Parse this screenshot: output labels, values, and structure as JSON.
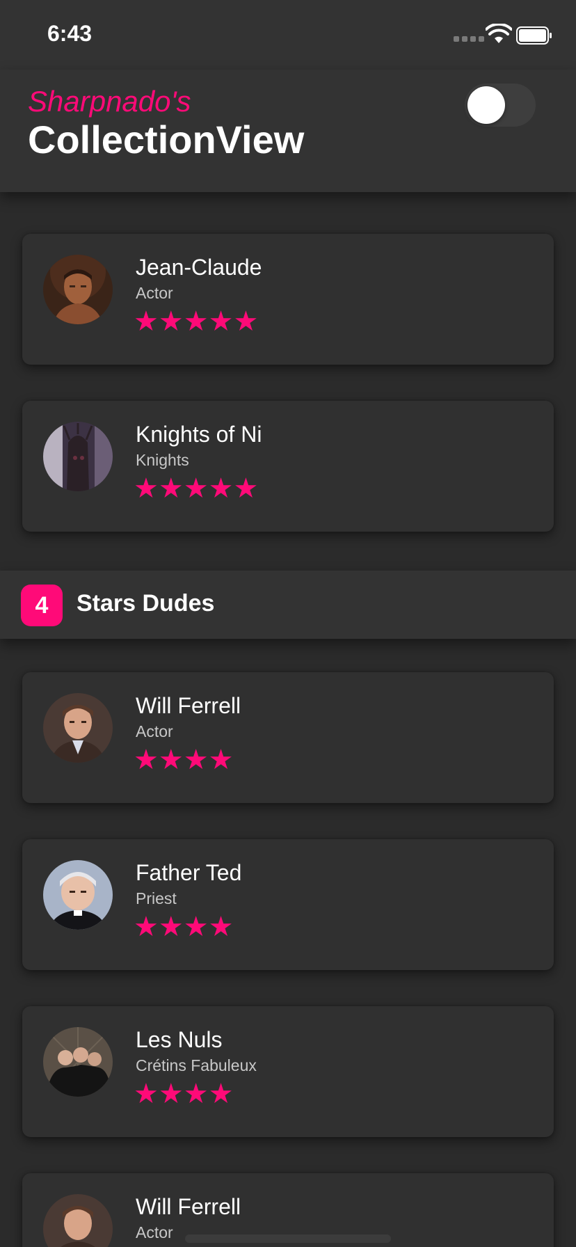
{
  "status_bar": {
    "time": "6:43"
  },
  "header": {
    "subtitle": "Sharpnado's",
    "title": "CollectionView"
  },
  "section_header": {
    "badge": "4",
    "label": "Stars Dudes"
  },
  "cards": [
    {
      "name": "Jean-Claude",
      "role": "Actor",
      "rating": 5,
      "stars": "★★★★★"
    },
    {
      "name": "Knights of Ni",
      "role": "Knights",
      "rating": 5,
      "stars": "★★★★★"
    },
    {
      "name": "Will Ferrell",
      "role": "Actor",
      "rating": 4,
      "stars": "★★★★"
    },
    {
      "name": "Father Ted",
      "role": "Priest",
      "rating": 4,
      "stars": "★★★★"
    },
    {
      "name": "Les Nuls",
      "role": "Crétins Fabuleux",
      "rating": 4,
      "stars": "★★★★"
    },
    {
      "name": "Will Ferrell",
      "role": "Actor"
    }
  ],
  "colors": {
    "accent": "#ff0a78",
    "background": "#2b2b2b",
    "card": "#303030",
    "header": "#333333"
  }
}
